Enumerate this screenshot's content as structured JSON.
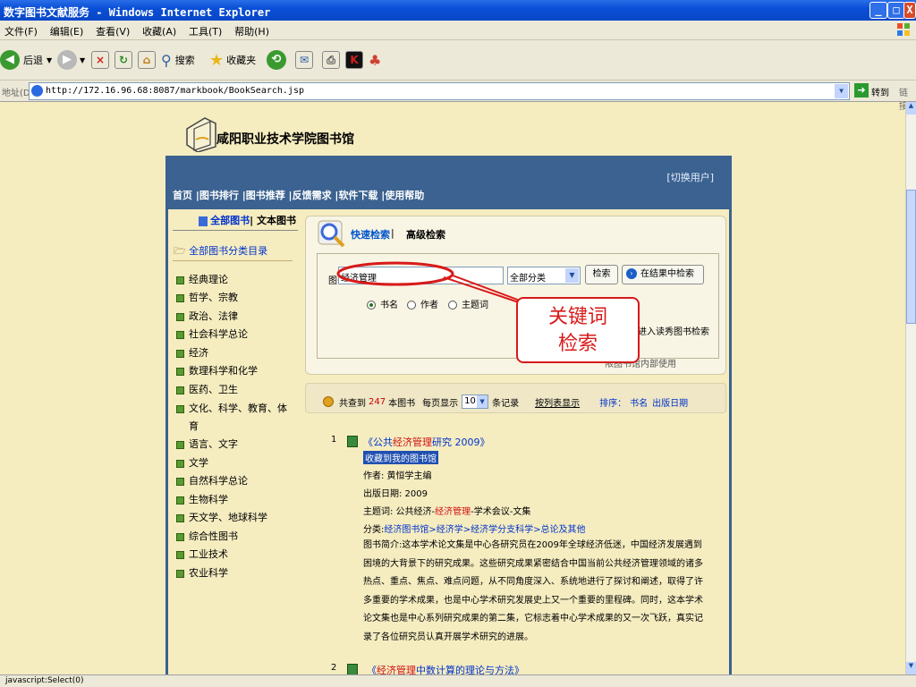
{
  "window": {
    "title": "数字图书文献服务 - Windows Internet Explorer",
    "buttons": [
      "_",
      "□",
      "X"
    ]
  },
  "menu": [
    "文件(F)",
    "编辑(E)",
    "查看(V)",
    "收藏(A)",
    "工具(T)",
    "帮助(H)"
  ],
  "toolbar": {
    "back": "后退",
    "search": "搜索",
    "favorites": "收藏夹"
  },
  "address": {
    "label": "地址(D)",
    "url": "http://172.16.96.68:8087/markbook/BookSearch.jsp",
    "go": "转到",
    "links": "链接"
  },
  "site": {
    "title": "咸阳职业技术学院图书馆",
    "switch_user": "[切换用户]",
    "nav": [
      "首页",
      "图书排行",
      "图书推荐",
      "反馈需求",
      "软件下载",
      "使用帮助"
    ]
  },
  "sidebar": {
    "tab_all": "全部图书",
    "tab_text": "文本图书",
    "root": "全部图书分类目录",
    "categories": [
      "经典理论",
      "哲学、宗教",
      "政治、法律",
      "社会科学总论",
      "经济",
      "数理科学和化学",
      "医药、卫生",
      "文化、科学、教育、体",
      "育",
      "语言、文字",
      "文学",
      "自然科学总论",
      "生物科学",
      "天文学、地球科学",
      "综合性图书",
      "工业技术",
      "农业科学"
    ]
  },
  "search": {
    "quick": "快速检索",
    "advanced": "高级检索",
    "label": "图书检索",
    "keyword": "经济管理",
    "category": "全部分类",
    "search_btn": "检索",
    "in_results_btn": "在结果中检索",
    "radio_title": "书名",
    "radio_author": "作者",
    "radio_subject": "主题词",
    "excellent": "进入读秀图书检索",
    "lib_note": "限图书馆内部使用"
  },
  "callout": {
    "line1": "关键词",
    "line2": "检索"
  },
  "results_bar": {
    "found_prefix": "共查到",
    "count": "247",
    "found_suffix": "本图书",
    "per_page_label": "每页显示",
    "per_page": "10",
    "per_page_suffix": "条记录",
    "list_view": "按列表显示",
    "sort_label": "排序：",
    "sort_title": "书名",
    "sort_date": "出版日期"
  },
  "results": [
    {
      "num": "1",
      "title_pre": "《公共",
      "title_hl": "经济管理",
      "title_post": "研究 2009》",
      "fav": "收藏到我的图书馆",
      "author": "作者: 黄恒学主编",
      "date": "出版日期: 2009",
      "subject_pre": "主题词: 公共经济-",
      "subject_hl": "经济管理",
      "subject_post": "-学术会议-文集",
      "class_label": "分类:",
      "class_path": "经济图书馆>经济学>经济学分支科学>总论及其他",
      "summary": "图书简介:这本学术论文集是中心各研究员在2009年全球经济低迷，中国经济发展遇到困境的大背景下的研究成果。这些研究成果紧密结合中国当前公共经济管理领域的诸多热点、重点、焦点、难点问题，从不同角度深入、系统地进行了探讨和阐述，取得了许多重要的学术成果，也是中心学术研究发展史上又一个重要的里程碑。同时，这本学术论文集也是中心系列研究成果的第二集，它标志着中心学术成果的又一次飞跃，真实记录了各位研究员认真开展学术研究的进展。"
    },
    {
      "num": "2",
      "title_pre": "《",
      "title_hl": "经济管理",
      "title_post": "中数计算的理论与方法》"
    }
  ],
  "status": {
    "text": "javascript:Select(0)"
  }
}
